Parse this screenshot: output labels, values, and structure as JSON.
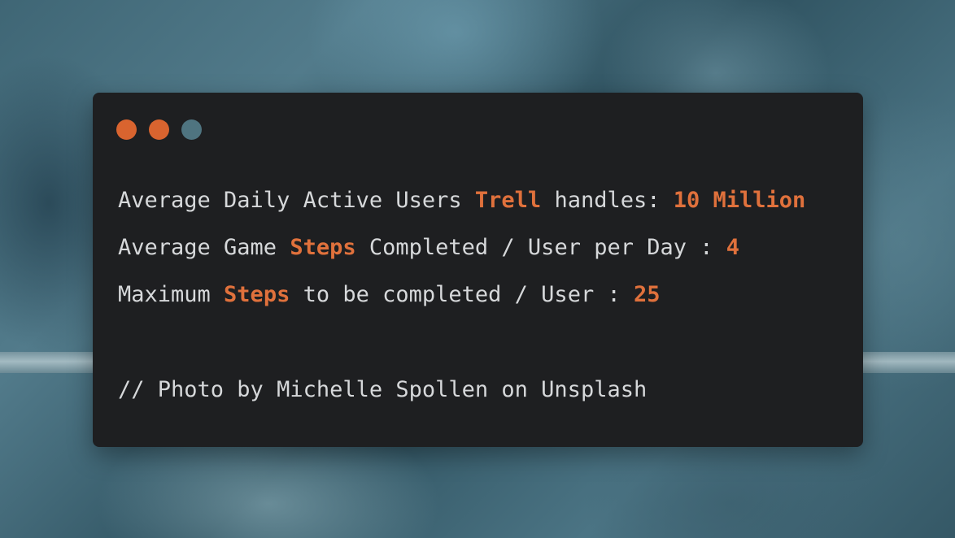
{
  "colors": {
    "accent": "#e0713c",
    "text": "#d6d8da",
    "card_background": "#1e1f21",
    "dots": [
      "#d9642f",
      "#d9642f",
      "#4f7480"
    ]
  },
  "window_controls": [
    "close-dot",
    "minimize-dot",
    "maximize-dot"
  ],
  "lines": [
    {
      "a": "Average Daily Active Users ",
      "hl1": "Trell",
      "b": " handles: ",
      "hl2": "10 Million"
    },
    {
      "a": "Average Game ",
      "hl1": "Steps",
      "b": " Completed / User per Day : ",
      "hl2": "4"
    },
    {
      "a": "Maximum ",
      "hl1": "Steps",
      "b": " to be completed / User : ",
      "hl2": "25"
    }
  ],
  "comment": "// Photo by Michelle Spollen on Unsplash"
}
